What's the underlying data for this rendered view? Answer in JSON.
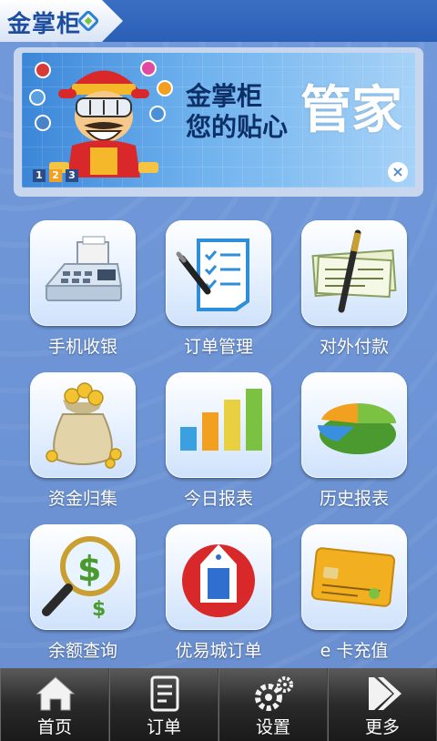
{
  "header": {
    "logo_text": "金掌柜"
  },
  "banner": {
    "line1": "金掌柜",
    "line2": "您的贴心",
    "big_text": "管家",
    "pages": [
      "1",
      "2",
      "3"
    ],
    "active_page": "2",
    "close_symbol": "×"
  },
  "tiles": [
    {
      "label": "手机收银",
      "icon": "cash-register-icon"
    },
    {
      "label": "订单管理",
      "icon": "checklist-icon"
    },
    {
      "label": "对外付款",
      "icon": "check-pen-icon"
    },
    {
      "label": "资金归集",
      "icon": "money-bag-icon"
    },
    {
      "label": "今日报表",
      "icon": "bar-chart-icon"
    },
    {
      "label": "历史报表",
      "icon": "pie-chart-icon"
    },
    {
      "label": "余额查询",
      "icon": "magnifier-dollar-icon"
    },
    {
      "label": "优易城订单",
      "icon": "shop-bag-icon"
    },
    {
      "label": "e 卡充值",
      "icon": "credit-card-icon"
    }
  ],
  "nav": [
    {
      "label": "首页",
      "icon": "home-icon"
    },
    {
      "label": "订单",
      "icon": "order-icon"
    },
    {
      "label": "设置",
      "icon": "gears-icon"
    },
    {
      "label": "更多",
      "icon": "arrow-right-icon"
    }
  ],
  "colors": {
    "header": "#2b5fb5",
    "background": "#6f95d6",
    "tile_label": "#ffffff",
    "nav_bg": "#1a1a1a"
  }
}
